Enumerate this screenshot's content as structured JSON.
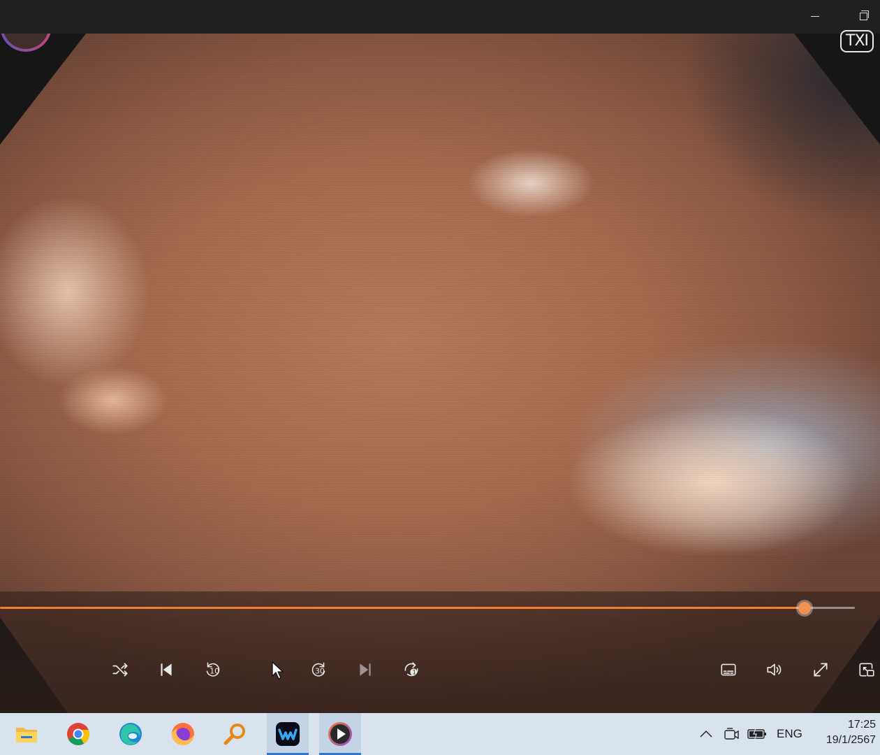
{
  "window": {
    "minimize_icon": "minimize-icon",
    "restore_icon": "restore-icon"
  },
  "video": {
    "overlay_badge": "TXI"
  },
  "playback": {
    "state": "playing",
    "progress": 0.941,
    "colors": {
      "accent": "#f07f2e",
      "track": "#9a8c87"
    }
  },
  "controls": {
    "shuffle": "shuffle-icon",
    "previous": "previous-icon",
    "skip_back": {
      "icon": "rewind-icon",
      "seconds": "10"
    },
    "play_pause": "pause-icon",
    "skip_forward": {
      "icon": "fast-forward-icon",
      "seconds": "30"
    },
    "next": "next-icon",
    "repeat": {
      "icon": "repeat-one-icon",
      "count": "1"
    },
    "captions": "captions-icon",
    "volume": "volume-icon",
    "fullscreen": "fullscreen-icon",
    "miniplayer": "miniplayer-icon"
  },
  "taskbar": {
    "apps": [
      "file-explorer",
      "chrome",
      "edge",
      "firefox",
      "search-tool",
      "webex",
      "media-player"
    ],
    "tray": {
      "language": "ENG",
      "time": "17:25",
      "date": "19/1/2567"
    },
    "colors": {
      "background": "#d9e3ee",
      "running_indicator": "#2b78d0"
    }
  }
}
